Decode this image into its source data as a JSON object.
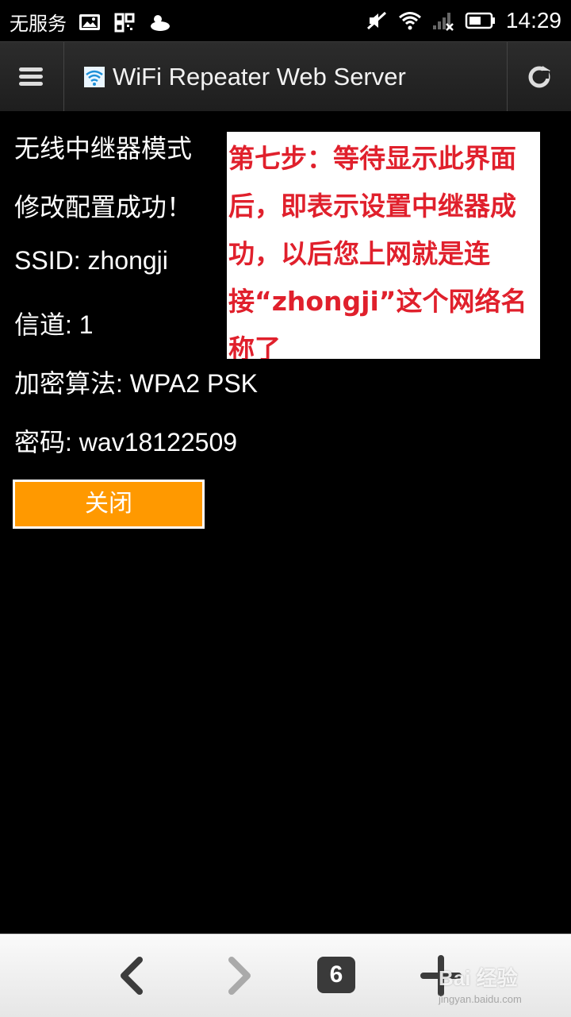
{
  "status_bar": {
    "carrier": "无服务",
    "time": "14:29",
    "icons": [
      "image-icon",
      "qr-icon",
      "weather-icon",
      "mute-icon",
      "wifi-icon",
      "signal-icon",
      "battery-icon"
    ]
  },
  "browser": {
    "title": "WiFi Repeater Web Server",
    "tab_count": "6"
  },
  "content": {
    "mode": "无线中继器模式",
    "success": "修改配置成功！",
    "ssid": "SSID: zhongji",
    "channel": "信道: 1",
    "encryption": "加密算法: WPA2 PSK",
    "password": "密码: wav18122509",
    "close_label": "关闭"
  },
  "annotation": {
    "text": "第七步：等待显示此界面后，即表示设置中继器成功，以后您上网就是连接“zhongji”这个网络名称了"
  },
  "watermark": {
    "brand": "Bai 经验",
    "url": "jingyan.baidu.com"
  },
  "colors": {
    "accent_button": "#ff9900",
    "annotation_text": "#e0202c"
  }
}
